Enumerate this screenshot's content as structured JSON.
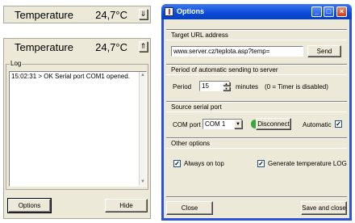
{
  "mini_widget_top": {
    "label": "Temperature",
    "value": "24,7°C",
    "toggle_glyph": "⇓"
  },
  "mini_widget_expanded": {
    "label": "Temperature",
    "value": "24,7°C",
    "toggle_glyph": "⇑"
  },
  "log": {
    "title": "Log",
    "entries": [
      "15:02:31 >  OK  Serial port COM1 opened."
    ]
  },
  "left_buttons": {
    "options": "Options",
    "hide": "Hide"
  },
  "options_window": {
    "title": "Options",
    "url_section": "Target URL address",
    "url_value": "www.server.cz/teplota.asp?temp=",
    "send_label": "Send",
    "period_section": "Period of automatic sending to server",
    "period_label": "Period",
    "period_value": "15",
    "period_unit": "minutes",
    "period_hint": "(0 = Timer is disabled)",
    "serial_section": "Source serial port",
    "com_label": "COM port",
    "com_value": "COM 1",
    "disconnect_label": "Disconnect",
    "automatic_label": "Automatic",
    "other_section": "Other options",
    "always_on_top_label": "Always on top",
    "generate_log_label": "Generate temperature LOG",
    "close_label": "Close",
    "save_close_label": "Save and close"
  },
  "colors": {
    "titlebar": "#0a4bd8",
    "window_bg": "#ece9d8",
    "connected_led": "#3aa83a"
  }
}
